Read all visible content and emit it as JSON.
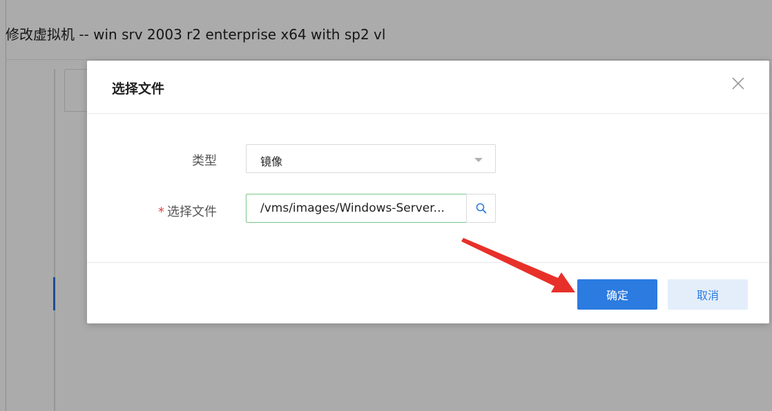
{
  "page": {
    "title": "修改虚拟机 -- win srv 2003 r2 enterprise x64 with sp2 vl"
  },
  "modal": {
    "title": "选择文件",
    "type_label": "类型",
    "type_value": "镜像",
    "file_label": "选择文件",
    "file_required_mark": "*",
    "file_value": "/vms/images/Windows-Server...",
    "confirm_label": "确定",
    "cancel_label": "取消"
  },
  "colors": {
    "primary": "#2b7be0",
    "secondary_bg": "#e4eefb",
    "annotation_arrow": "#e8302a",
    "valid_border": "#7cc68a"
  }
}
